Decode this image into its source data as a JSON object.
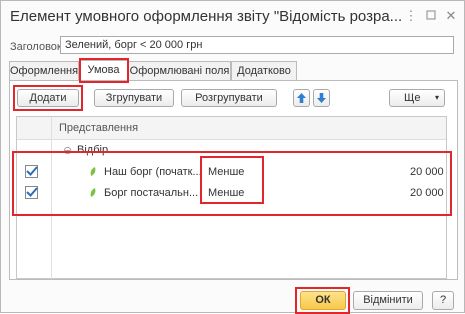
{
  "window": {
    "title": "Елемент умовного оформлення звіту \"Відомість розра...",
    "menu_icon": "kebab-menu-icon",
    "maximize_icon": "maximize-icon",
    "close_icon": "close-icon"
  },
  "heading": {
    "label": "Заголовок:",
    "value": "Зелений, борг < 20 000 грн"
  },
  "tabs": [
    {
      "label": "Оформлення"
    },
    {
      "label": "Умова"
    },
    {
      "label": "Оформлювані поля"
    },
    {
      "label": "Додатково"
    }
  ],
  "toolbar": {
    "add": "Додати",
    "group": "Згрупувати",
    "ungroup": "Розгрупувати",
    "more": "Ще",
    "up_icon": "arrow-up-icon",
    "down_icon": "arrow-down-icon"
  },
  "table": {
    "header": "Представлення",
    "group_row": "Відбір",
    "rows": [
      {
        "checked": true,
        "field": "Наш борг (початк...",
        "condition": "Менше",
        "value": "20 000"
      },
      {
        "checked": true,
        "field": "Борг постачальн...",
        "condition": "Менше",
        "value": "20 000"
      }
    ]
  },
  "footer": {
    "ok": "ОК",
    "cancel": "Відмінити",
    "help": "?"
  },
  "colors": {
    "highlight": "#e3262b",
    "ok_button": "#f6c84b",
    "checkbox_check": "#2a6ebb"
  }
}
